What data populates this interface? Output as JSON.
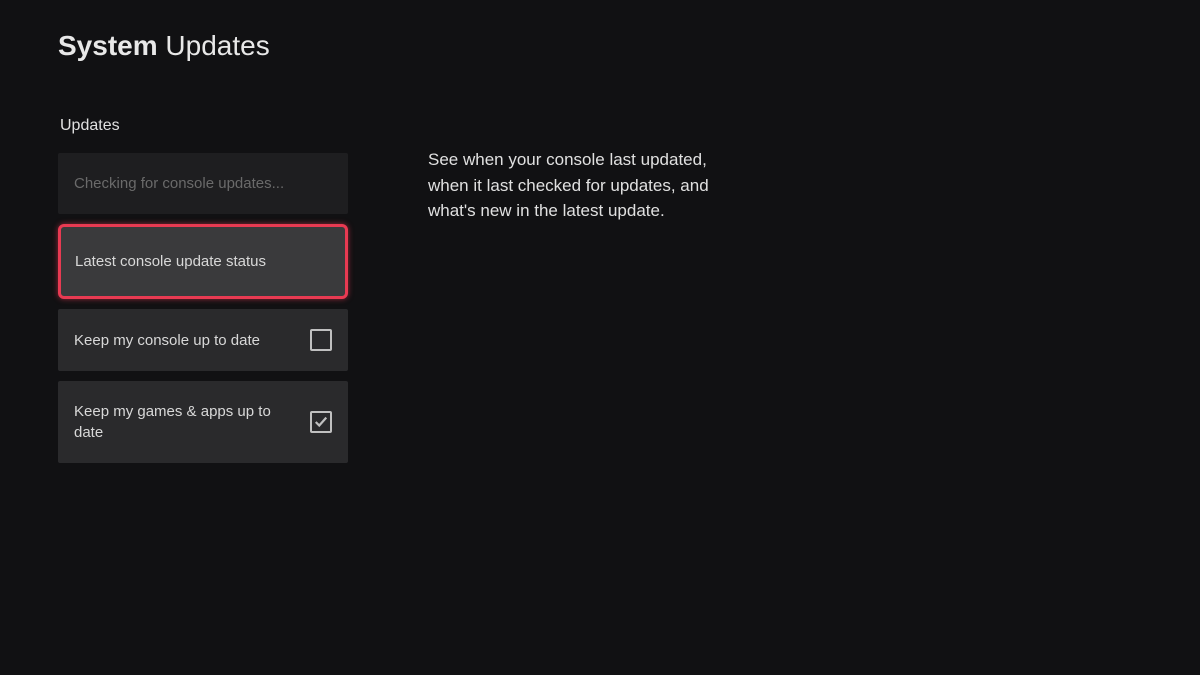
{
  "header": {
    "title_bold": "System",
    "title_rest": "Updates"
  },
  "section_label": "Updates",
  "menu": {
    "checking": "Checking for console updates...",
    "latest_status": "Latest console update status",
    "keep_console": "Keep my console up to date",
    "keep_games": "Keep my games & apps up to date"
  },
  "description": "See when your console last updated, when it last checked for updates, and what's new in the latest update."
}
